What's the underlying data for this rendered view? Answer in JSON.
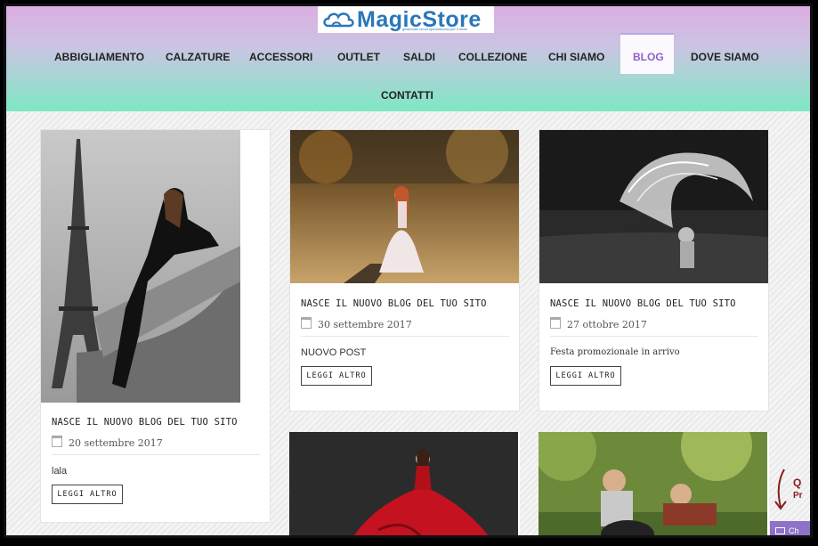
{
  "brand": {
    "name": "MagicStore",
    "tagline": "gestionale cloud specializzato per il retail"
  },
  "nav": {
    "items": [
      {
        "label": "ABBIGLIAMENTO"
      },
      {
        "label": "CALZATURE"
      },
      {
        "label": "ACCESSORI"
      },
      {
        "label": "OUTLET"
      },
      {
        "label": "SALDI"
      },
      {
        "label": "COLLEZIONE"
      },
      {
        "label": "CHI SIAMO"
      },
      {
        "label": "BLOG",
        "active": true
      },
      {
        "label": "DOVE SIAMO"
      },
      {
        "label": "CONTATTI"
      }
    ]
  },
  "posts": [
    {
      "title": "NASCE IL NUOVO BLOG DEL TUO SITO",
      "date": "20 settembre 2017",
      "excerpt": "lala",
      "button": "LEGGI ALTRO",
      "image": "eiffel-tower-woman"
    },
    {
      "title": "NASCE IL NUOVO BLOG DEL TUO SITO",
      "date": "30 settembre 2017",
      "excerpt": "NUOVO POST",
      "button": "LEGGI ALTRO",
      "image": "woman-on-dock"
    },
    {
      "title": "NASCE IL NUOVO BLOG DEL TUO SITO",
      "date": "27 ottobre 2017",
      "excerpt": "Festa promozionale in arrivo",
      "button": "LEGGI ALTRO",
      "image": "hair-splash"
    },
    {
      "image": "red-dress"
    },
    {
      "image": "children-dog"
    }
  ],
  "edge": {
    "line1": "Q",
    "line2": "Pr",
    "chat": "Ch"
  },
  "colors": {
    "header_top": "#dcaee2",
    "header_bottom": "#7ee8c4",
    "nav_active": "#8a63c8",
    "logo_blue": "#2a77b8",
    "chat_purple": "#8d72c7"
  }
}
